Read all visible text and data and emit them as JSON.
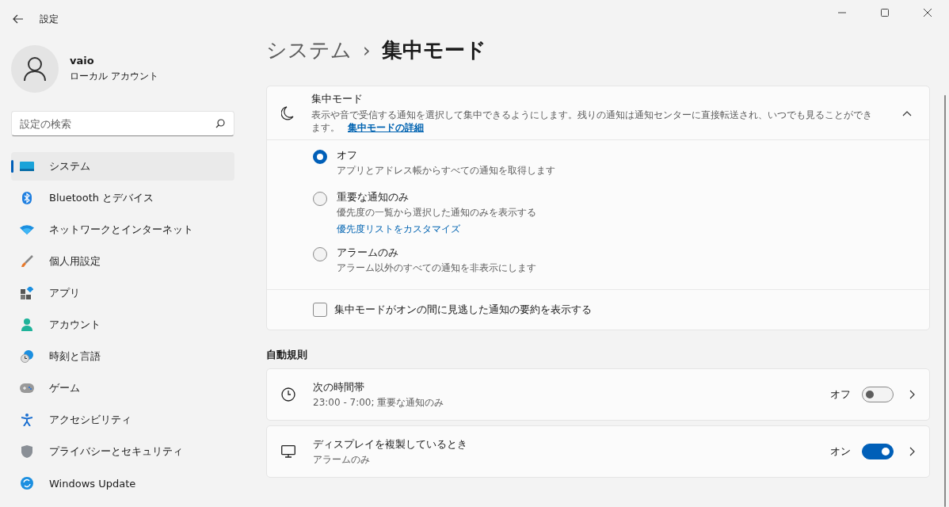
{
  "window": {
    "title": "設定"
  },
  "user": {
    "name": "vaio",
    "account": "ローカル アカウント"
  },
  "search": {
    "placeholder": "設定の検索"
  },
  "nav": [
    {
      "label": "システム",
      "selected": true
    },
    {
      "label": "Bluetooth とデバイス",
      "selected": false
    },
    {
      "label": "ネットワークとインターネット",
      "selected": false
    },
    {
      "label": "個人用設定",
      "selected": false
    },
    {
      "label": "アプリ",
      "selected": false
    },
    {
      "label": "アカウント",
      "selected": false
    },
    {
      "label": "時刻と言語",
      "selected": false
    },
    {
      "label": "ゲーム",
      "selected": false
    },
    {
      "label": "アクセシビリティ",
      "selected": false
    },
    {
      "label": "プライバシーとセキュリティ",
      "selected": false
    },
    {
      "label": "Windows Update",
      "selected": false
    }
  ],
  "breadcrumb": {
    "parent": "システム",
    "separator": "›",
    "current": "集中モード"
  },
  "focus_card": {
    "title": "集中モード",
    "description": "表示や音で受信する通知を選択して集中できるようにします。残りの通知は通知センターに直接転送され、いつでも見ることができます。",
    "link": "集中モードの詳細",
    "expanded": true,
    "options": [
      {
        "label": "オフ",
        "description": "アプリとアドレス帳からすべての通知を取得します",
        "selected": true
      },
      {
        "label": "重要な通知のみ",
        "description": "優先度の一覧から選択した通知のみを表示する",
        "link": "優先度リストをカスタマイズ",
        "selected": false
      },
      {
        "label": "アラームのみ",
        "description": "アラーム以外のすべての通知を非表示にします",
        "selected": false
      }
    ],
    "summary": {
      "label": "集中モードがオンの間に見逃した通知の要約を表示する",
      "checked": false
    }
  },
  "section_title": "自動規則",
  "rules": [
    {
      "kind": "clock",
      "title": "次の時間帯",
      "subtitle": "23:00 - 7:00; 重要な通知のみ",
      "state_label": "オフ",
      "on": false
    },
    {
      "kind": "display",
      "title": "ディスプレイを複製しているとき",
      "subtitle": "アラームのみ",
      "state_label": "オン",
      "on": true
    }
  ]
}
